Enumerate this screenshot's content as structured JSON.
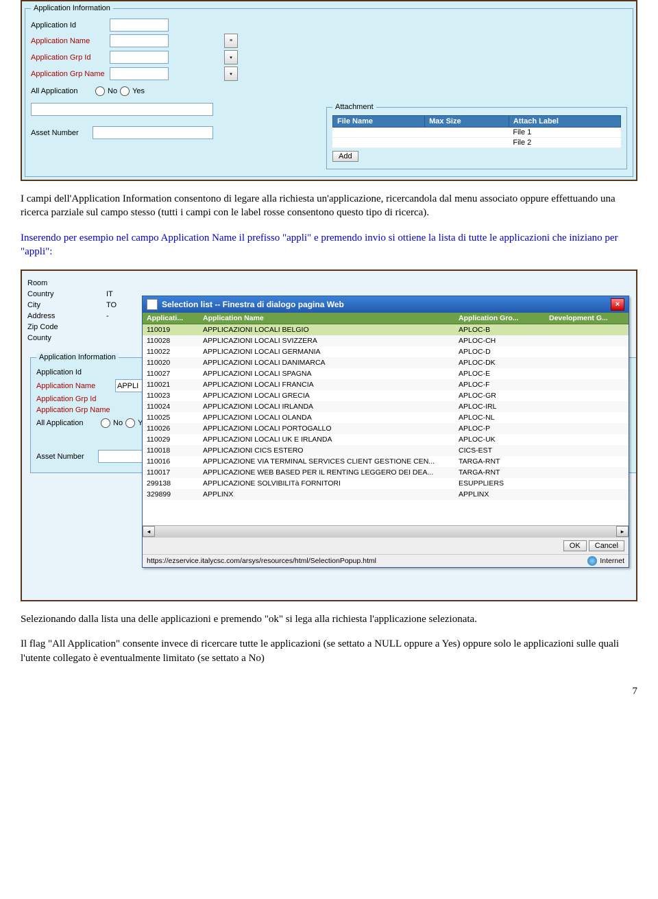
{
  "screenshot1": {
    "fieldset_title": "Application Information",
    "fields": {
      "app_id_label": "Application Id",
      "app_name_label": "Application Name",
      "app_grp_id_label": "Application Grp Id",
      "app_grp_name_label": "Application Grp Name"
    },
    "all_app_label": "All Application",
    "radio_no": "No",
    "radio_yes": "Yes",
    "asset_number_label": "Asset Number",
    "attachment_label": "Attachment",
    "attach_headers": {
      "file": "File Name",
      "size": "Max Size",
      "label": "Attach Label"
    },
    "attach_rows": [
      "File 1",
      "File 2"
    ],
    "add_btn": "Add"
  },
  "para1": "I campi dell'Application Information consentono di legare alla richiesta un'applicazione, ricercandola dal menu associato oppure effettuando una ricerca parziale sul campo stesso (tutti i campi con le label rosse consentono questo tipo di ricerca).",
  "para2": "Inserendo per esempio nel campo Application Name il prefisso \"appli\" e premendo invio si ottiene la lista di tutte le applicazioni che iniziano per \"appli\":",
  "screenshot2": {
    "left": {
      "room": "Room",
      "country": "Country",
      "country_val": "IT",
      "city": "City",
      "city_val": "TO",
      "address": "Address",
      "address_val": "-",
      "zip": "Zip Code",
      "county": "County",
      "app_info_legend": "Application Information",
      "app_id": "Application Id",
      "app_name": "Application Name",
      "app_name_val": "APPLI",
      "app_grp_id": "Application Grp Id",
      "app_grp_name": "Application Grp Name",
      "all_app": "All Application",
      "no": "No",
      "yes": "Yes",
      "asset_number": "Asset Number"
    },
    "dialog": {
      "title": "Selection list -- Finestra di dialogo pagina Web",
      "columns": {
        "id": "Applicati...",
        "name": "Application Name",
        "grp": "Application Gro...",
        "dev": "Development G..."
      },
      "rows": [
        {
          "id": "110019",
          "name": "APPLICAZIONI LOCALI BELGIO",
          "grp": "APLOC-B"
        },
        {
          "id": "110028",
          "name": "APPLICAZIONI LOCALI SVIZZERA",
          "grp": "APLOC-CH"
        },
        {
          "id": "110022",
          "name": "APPLICAZIONI LOCALI GERMANIA",
          "grp": "APLOC-D"
        },
        {
          "id": "110020",
          "name": "APPLICAZIONI LOCALI DANIMARCA",
          "grp": "APLOC-DK"
        },
        {
          "id": "110027",
          "name": "APPLICAZIONI LOCALI SPAGNA",
          "grp": "APLOC-E"
        },
        {
          "id": "110021",
          "name": "APPLICAZIONI LOCALI FRANCIA",
          "grp": "APLOC-F"
        },
        {
          "id": "110023",
          "name": "APPLICAZIONI LOCALI GRECIA",
          "grp": "APLOC-GR"
        },
        {
          "id": "110024",
          "name": "APPLICAZIONI LOCALI IRLANDA",
          "grp": "APLOC-IRL"
        },
        {
          "id": "110025",
          "name": "APPLICAZIONI LOCALI OLANDA",
          "grp": "APLOC-NL"
        },
        {
          "id": "110026",
          "name": "APPLICAZIONI LOCALI PORTOGALLO",
          "grp": "APLOC-P"
        },
        {
          "id": "110029",
          "name": "APPLICAZIONI LOCALI UK E IRLANDA",
          "grp": "APLOC-UK"
        },
        {
          "id": "110018",
          "name": "APPLICAZIONI CICS ESTERO",
          "grp": "CICS-EST"
        },
        {
          "id": "110016",
          "name": "APPLICAZIONE VIA TERMINAL SERVICES CLIENT GESTIONE CEN...",
          "grp": "TARGA-RNT"
        },
        {
          "id": "110017",
          "name": "APPLICAZIONE WEB BASED PER IL RENTING LEGGERO DEI DEA...",
          "grp": "TARGA-RNT"
        },
        {
          "id": "299138",
          "name": "APPLICAZIONE SOLVIBILITà FORNITORI",
          "grp": "ESUPPLIERS"
        },
        {
          "id": "329899",
          "name": "APPLINX",
          "grp": "APPLINX"
        }
      ],
      "ok": "OK",
      "cancel": "Cancel",
      "url": "https://ezservice.italycsc.com/arsys/resources/html/SelectionPopup.html",
      "zone": "Internet"
    }
  },
  "para3": "Selezionando dalla lista una delle applicazioni e premendo \"ok\" si lega alla richiesta l'applicazione selezionata.",
  "para4": "Il flag \"All Application\" consente invece di ricercare tutte le applicazioni (se settato a NULL oppure a Yes) oppure solo le applicazioni sulle quali l'utente collegato è eventualmente limitato (se settato a No)",
  "page_number": "7"
}
